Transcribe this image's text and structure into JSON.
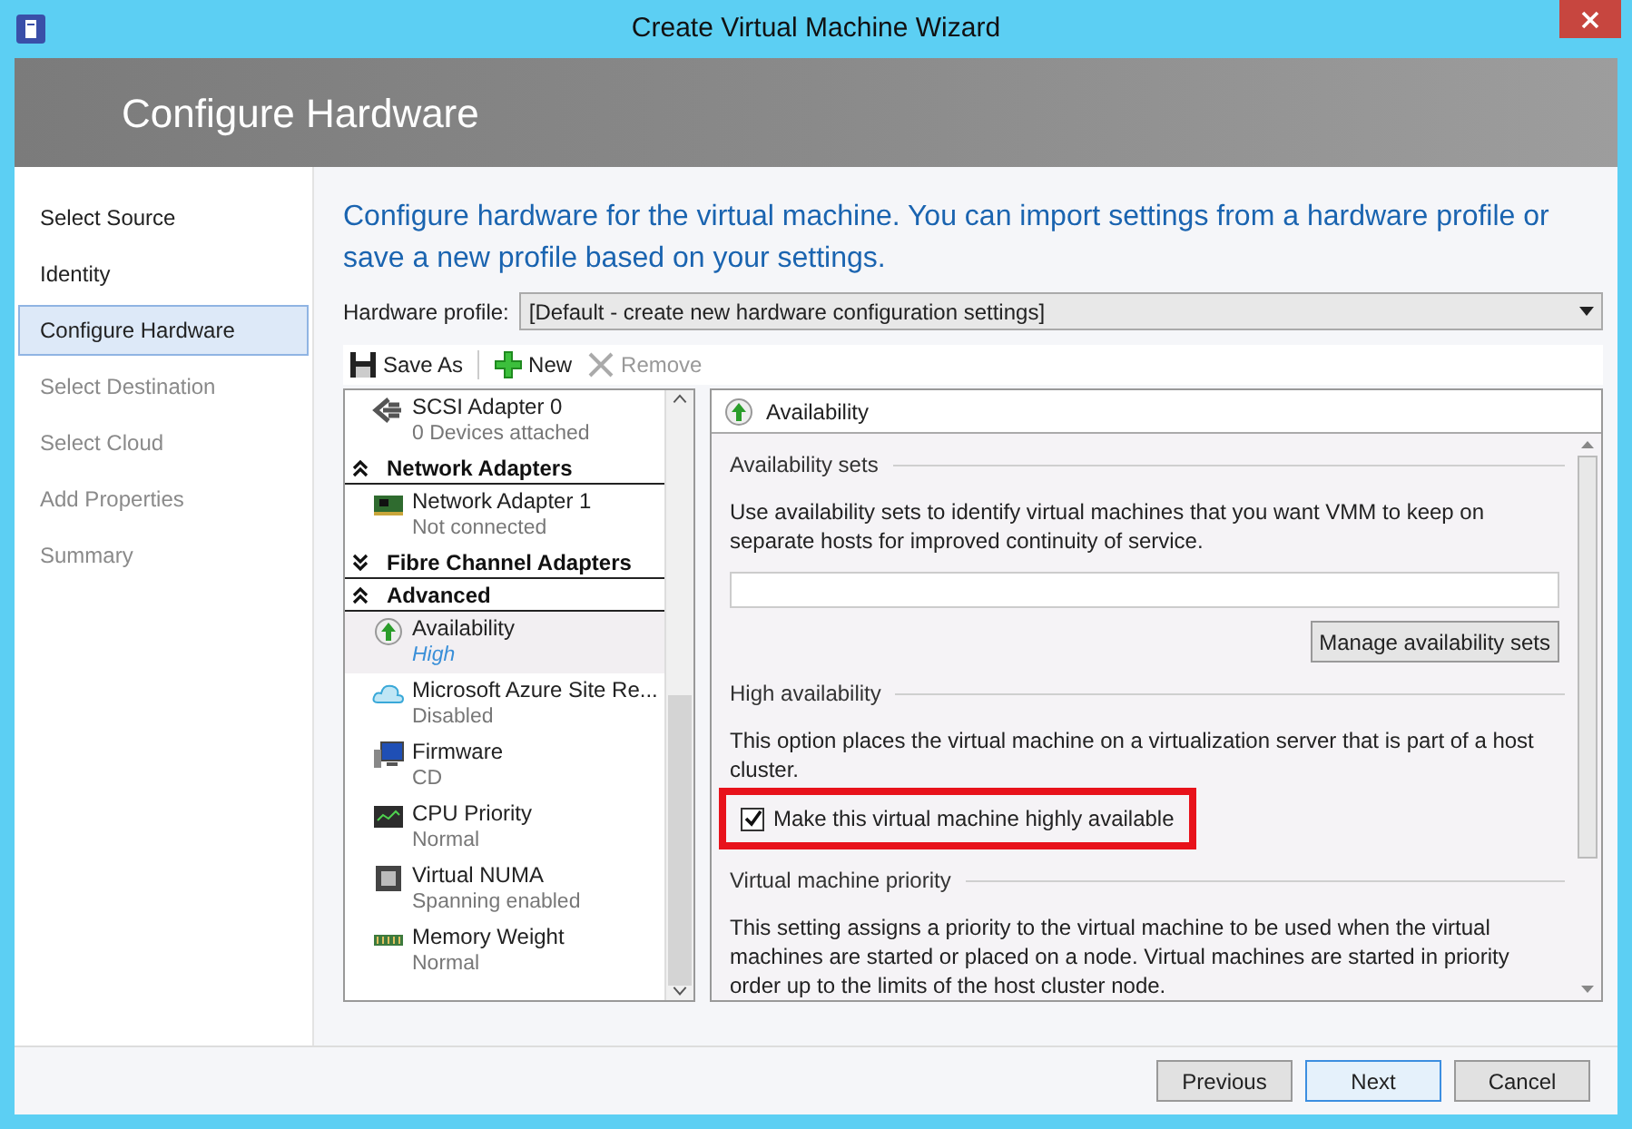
{
  "window": {
    "title": "Create Virtual Machine Wizard"
  },
  "header": {
    "title": "Configure Hardware"
  },
  "steps": [
    {
      "label": "Select Source",
      "selected": false,
      "disabled": false
    },
    {
      "label": "Identity",
      "selected": false,
      "disabled": false
    },
    {
      "label": "Configure Hardware",
      "selected": true,
      "disabled": false
    },
    {
      "label": "Select Destination",
      "selected": false,
      "disabled": true
    },
    {
      "label": "Select Cloud",
      "selected": false,
      "disabled": true
    },
    {
      "label": "Add Properties",
      "selected": false,
      "disabled": true
    },
    {
      "label": "Summary",
      "selected": false,
      "disabled": true
    }
  ],
  "intro": "Configure hardware for the virtual machine. You can import settings from a hardware profile or save a new profile based on your settings.",
  "hardware_profile": {
    "label": "Hardware profile:",
    "value": "[Default - create new hardware configuration settings]"
  },
  "toolbar": [
    {
      "label": "Save As",
      "kind": "save",
      "disabled": false
    },
    {
      "label": "New",
      "kind": "new",
      "disabled": false
    },
    {
      "label": "Remove",
      "kind": "remove",
      "disabled": true
    }
  ],
  "hardware_list": [
    {
      "kind": "device",
      "name": "SCSI Adapter 0",
      "detail": "0 Devices attached",
      "selected": false
    },
    {
      "kind": "group",
      "name": "Network Adapters",
      "expanded": true
    },
    {
      "kind": "device",
      "name": "Network Adapter 1",
      "detail": "Not connected",
      "selected": false
    },
    {
      "kind": "group",
      "name": "Fibre Channel Adapters",
      "expanded": false
    },
    {
      "kind": "group",
      "name": "Advanced",
      "expanded": true
    },
    {
      "kind": "device",
      "name": "Availability",
      "detail": "High",
      "selected": true
    },
    {
      "kind": "device",
      "name": "Microsoft Azure Site Re...",
      "detail": "Disabled",
      "selected": false
    },
    {
      "kind": "device",
      "name": "Firmware",
      "detail": "CD",
      "selected": false
    },
    {
      "kind": "device",
      "name": "CPU Priority",
      "detail": "Normal",
      "selected": false
    },
    {
      "kind": "device",
      "name": "Virtual NUMA",
      "detail": "Spanning enabled",
      "selected": false
    },
    {
      "kind": "device",
      "name": "Memory Weight",
      "detail": "Normal",
      "selected": false
    }
  ],
  "detail_panel": {
    "title": "Availability",
    "availability_sets": {
      "heading": "Availability sets",
      "text": "Use availability sets to identify virtual machines that you want VMM to keep on separate hosts for improved continuity of service.",
      "button": "Manage availability sets"
    },
    "high_availability": {
      "heading": "High availability",
      "text": "This option places the virtual machine on a virtualization server that is part of a host cluster.",
      "checkbox": {
        "label": "Make this virtual machine highly available",
        "checked": true,
        "highlighted": true
      }
    },
    "priority": {
      "heading": "Virtual machine priority",
      "text": "This setting assigns a priority to the virtual machine to be used when the virtual machines are started or placed on a node. Virtual machines are started in priority order up to the limits of the host cluster node."
    }
  },
  "buttons": [
    {
      "label": "Previous",
      "default": false
    },
    {
      "label": "Next",
      "default": true
    },
    {
      "label": "Cancel",
      "default": false
    }
  ]
}
